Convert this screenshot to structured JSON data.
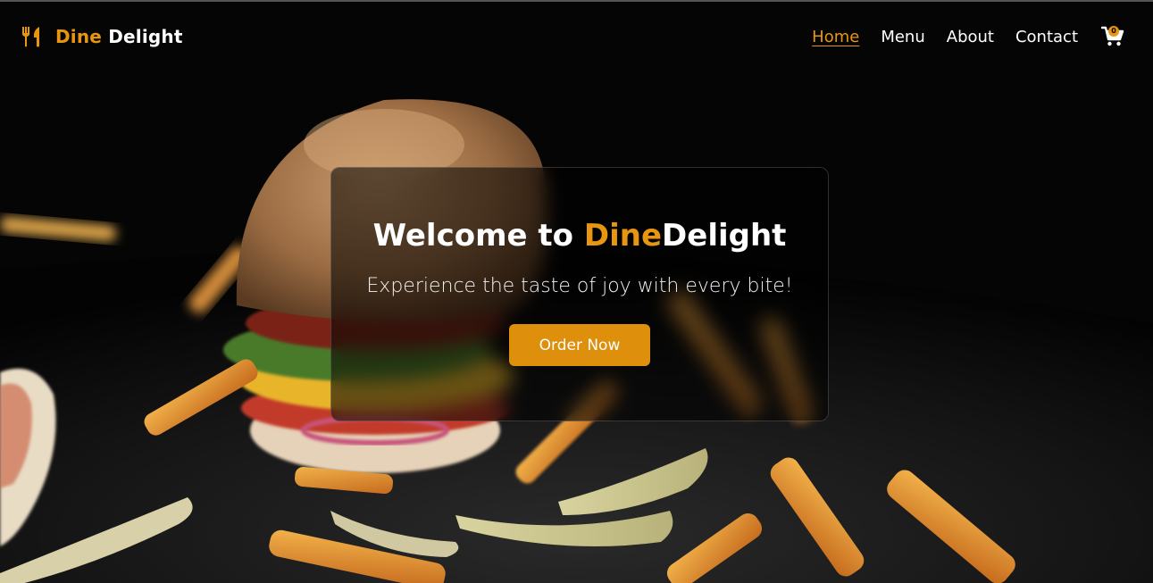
{
  "nav": {
    "brand_first": "Dine",
    "brand_second": "Delight",
    "brand_icon": "utensils-icon",
    "links": [
      {
        "label": "Home",
        "active": true
      },
      {
        "label": "Menu",
        "active": false
      },
      {
        "label": "About",
        "active": false
      },
      {
        "label": "Contact",
        "active": false
      }
    ],
    "cart_icon": "shopping-cart-icon",
    "cart_count": "0"
  },
  "hero": {
    "title_prefix": "Welcome to ",
    "title_dine": "Dine",
    "title_delight": "Delight",
    "subtitle": "Experience the taste of joy with every bite!",
    "cta_label": "Order Now",
    "background_image": "burger-and-fries-photo"
  },
  "colors": {
    "accent": "#e8960f",
    "button": "#de8f0c",
    "background": "#050505",
    "text": "#ffffff"
  }
}
